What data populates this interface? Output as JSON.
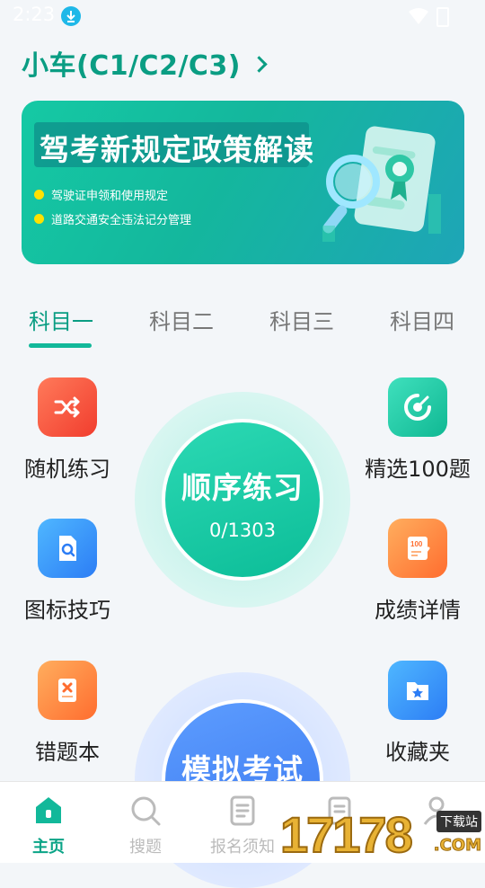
{
  "status_bar": {
    "time": "2:23"
  },
  "header": {
    "vehicle_type": "小车(C1/C2/C3)"
  },
  "banner": {
    "title": "驾考新规定政策解读",
    "bullets": [
      "驾驶证申领和使用规定",
      "道路交通安全违法记分管理"
    ]
  },
  "tabs": [
    {
      "label": "科目一",
      "active": true
    },
    {
      "label": "科目二",
      "active": false
    },
    {
      "label": "科目三",
      "active": false
    },
    {
      "label": "科目四",
      "active": false
    }
  ],
  "features": {
    "random": "随机练习",
    "selected": "精选100题",
    "icon_tips": "图标技巧",
    "score_detail": "成绩详情",
    "wrong_book": "错题本",
    "favorites": "收藏夹"
  },
  "sequential": {
    "label": "顺序练习",
    "progress": "0/1303"
  },
  "mock_exam": {
    "label": "模拟考试"
  },
  "bottom_nav": [
    {
      "label": "主页",
      "icon": "home-icon",
      "active": true
    },
    {
      "label": "搜题",
      "icon": "search-icon",
      "active": false
    },
    {
      "label": "报名须知",
      "icon": "document-icon",
      "active": false
    },
    {
      "label": "",
      "icon": "notes-icon",
      "active": false
    },
    {
      "label": "",
      "icon": "profile-icon",
      "active": false
    }
  ],
  "watermark": {
    "number": "17178",
    "tag": "下载站",
    "suffix": ".COM"
  },
  "colors": {
    "accent": "#0a9d83",
    "mock_blue": "#3a77ee"
  }
}
